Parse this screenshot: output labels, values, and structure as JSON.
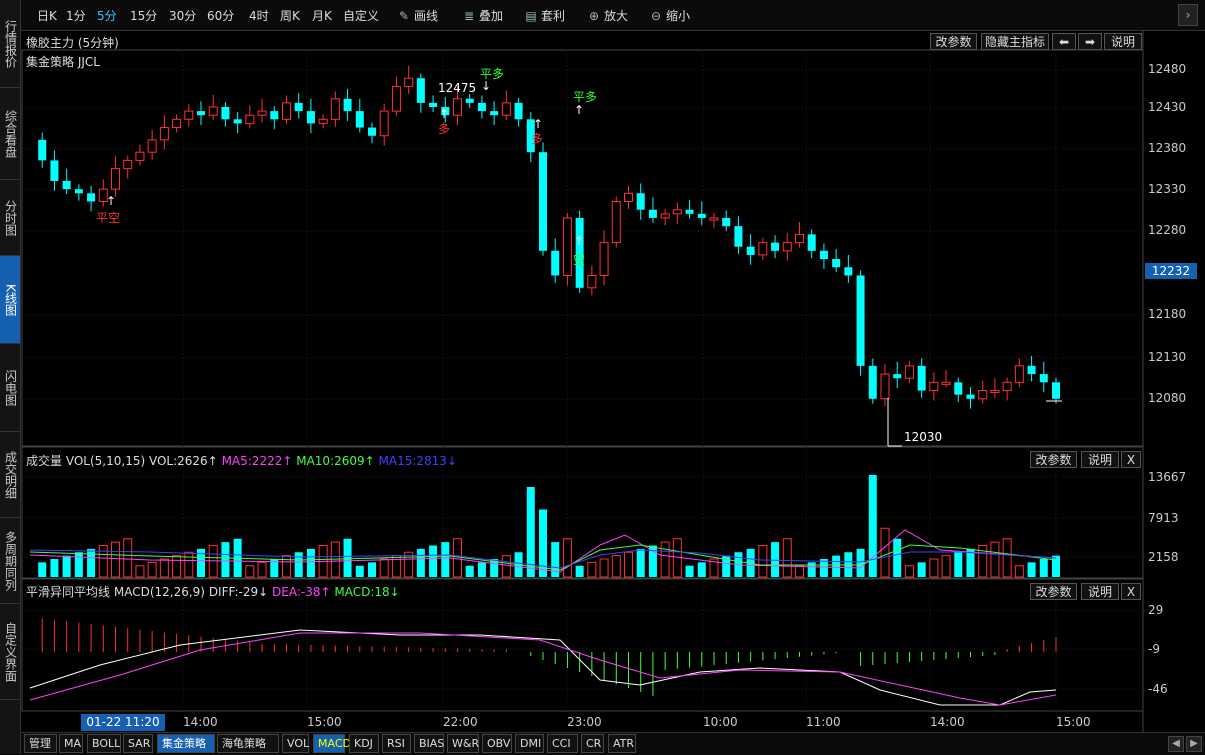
{
  "sidebar": {
    "items": [
      {
        "label": "行情报价",
        "active": false
      },
      {
        "label": "综合看盘",
        "active": false
      },
      {
        "label": "分时图",
        "active": false
      },
      {
        "label": "K线图",
        "active": true
      },
      {
        "label": "闪电图",
        "active": false
      },
      {
        "label": "成交明细",
        "active": false
      },
      {
        "label": "多周期同列",
        "active": false
      },
      {
        "label": "自定义界面",
        "active": false
      }
    ]
  },
  "toolbar": {
    "periods": [
      "日K",
      "1分",
      "5分",
      "15分",
      "30分",
      "60分",
      "4时",
      "周K",
      "月K",
      "自定义"
    ],
    "active_period": "5分",
    "tools": [
      {
        "label": "画线",
        "icon": "pencil-icon"
      },
      {
        "label": "叠加",
        "icon": "stack-icon"
      },
      {
        "label": "套利",
        "icon": "arbitrage-icon"
      },
      {
        "label": "放大",
        "icon": "zoom-in-icon"
      },
      {
        "label": "缩小",
        "icon": "zoom-out-icon"
      }
    ]
  },
  "main_panel": {
    "title": "橡胶主力 (5分钟)",
    "strategy": "集金策略 JJCL",
    "buttons": {
      "params": "改参数",
      "hide": "隐藏主指标",
      "explain": "说明"
    },
    "y_ticks": [
      "12480",
      "12430",
      "12380",
      "12330",
      "12280",
      "12180",
      "12130",
      "12080"
    ],
    "current_price": "12232",
    "high_label": "12475",
    "low_label": "12030",
    "signals": [
      {
        "text": "平空",
        "color": "#ff3030"
      },
      {
        "text": "平多",
        "color": "#30ff30"
      },
      {
        "text": "多",
        "color": "#ff3030"
      },
      {
        "text": "多",
        "color": "#ff3030"
      },
      {
        "text": "平多",
        "color": "#30ff30"
      },
      {
        "text": "空",
        "color": "#30ff30"
      }
    ]
  },
  "volume_panel": {
    "title": "成交量",
    "params": "VOL(5,10,15)",
    "vol": "VOL:2626↑",
    "ma5": "MA5:2222↑",
    "ma10": "MA10:2609↑",
    "ma15": "MA15:2813↓",
    "buttons": {
      "params": "改参数",
      "explain": "说明",
      "close": "X"
    },
    "y_ticks": [
      "13667",
      "7913",
      "2158"
    ]
  },
  "macd_panel": {
    "title": "平滑异同平均线",
    "params": "MACD(12,26,9)",
    "diff": "DIFF:-29↓",
    "dea": "DEA:-38↑",
    "macd": "MACD:18↓",
    "buttons": {
      "params": "改参数",
      "explain": "说明",
      "close": "X"
    },
    "y_ticks": [
      "29",
      "-9",
      "-46"
    ]
  },
  "time_axis": {
    "cursor": "01-22 11:20",
    "labels": [
      "14:00",
      "15:00",
      "22:00",
      "23:00",
      "10:00",
      "11:00",
      "14:00",
      "15:00"
    ]
  },
  "bottom_tabs": {
    "items": [
      "管理",
      "MA",
      "BOLL",
      "SAR",
      "集金策略",
      "海龟策略",
      "VOL",
      "MACD",
      "KDJ",
      "RSI",
      "BIAS",
      "W&R",
      "OBV",
      "DMI",
      "CCI",
      "CR",
      "ATR"
    ],
    "active": "集金策略",
    "highlighted": "MACD"
  },
  "colors": {
    "up": "#ff3030",
    "down": "#00ffff",
    "ma5": "#ff40ff",
    "ma10": "#40ff40",
    "ma15": "#4040ff",
    "accent": "#1560b0"
  }
}
